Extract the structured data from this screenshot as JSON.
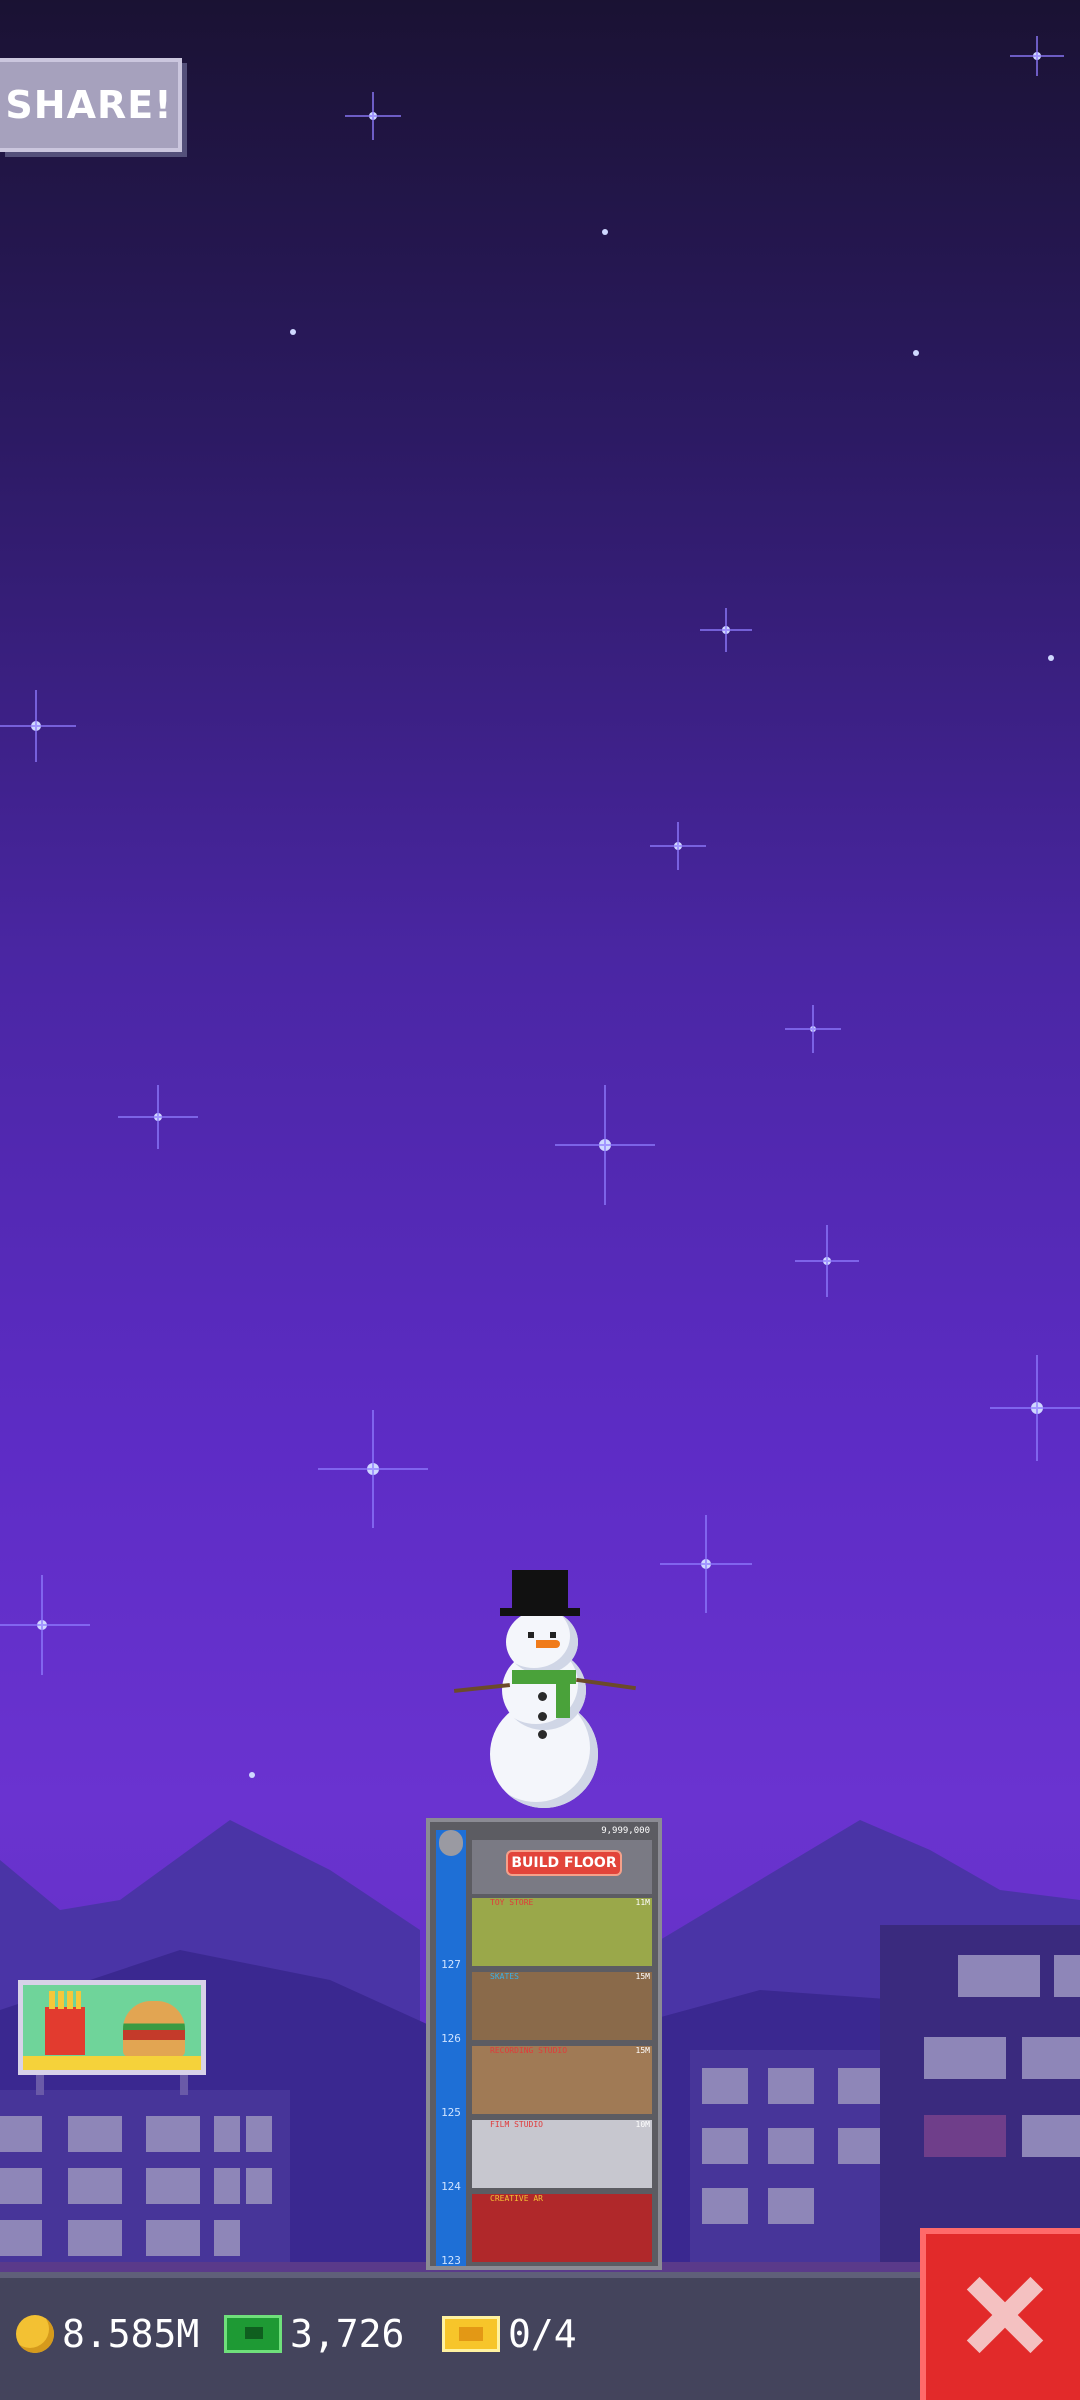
{
  "hud": {
    "share_label": "SHARE!",
    "coins": "8.585M",
    "cash": "3,726",
    "tickets": "0/4"
  },
  "tower": {
    "price": "9,999,000",
    "build_label": "BUILD FLOOR",
    "floors": [
      {
        "number": "127",
        "name": "TOY STORE",
        "stock": "11M"
      },
      {
        "number": "126",
        "name": "SKATES",
        "stock": "15M"
      },
      {
        "number": "125",
        "name": "RECORDING STUDIO",
        "stock": "15M"
      },
      {
        "number": "124",
        "name": "FILM STUDIO",
        "stock": "10M"
      },
      {
        "number": "123",
        "name": "CREATIVE AR",
        "stock": ""
      }
    ]
  },
  "colors": {
    "sky_top": "#1a1233",
    "sky_bottom": "#6a33d0",
    "close_button": "#e22a2a",
    "elevator": "#1e6fd6"
  }
}
